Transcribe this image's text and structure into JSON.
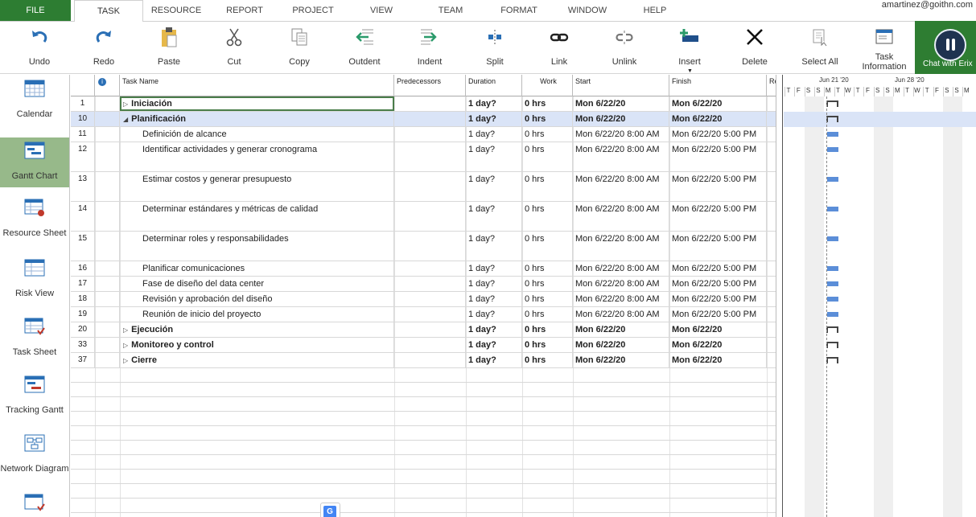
{
  "user": "amartinez@goithn.com",
  "tabs": [
    "FILE",
    "TASK",
    "RESOURCE",
    "REPORT",
    "PROJECT",
    "VIEW",
    "TEAM",
    "FORMAT",
    "WINDOW",
    "HELP"
  ],
  "ribbon": {
    "undo": "Undo",
    "redo": "Redo",
    "paste": "Paste",
    "cut": "Cut",
    "copy": "Copy",
    "outdent": "Outdent",
    "indent": "Indent",
    "split": "Split",
    "link": "Link",
    "unlink": "Unlink",
    "insert": "Insert",
    "delete": "Delete",
    "select_all": "Select All",
    "task_information": "Task Information",
    "chat": "Chat with Erix"
  },
  "views": [
    "Calendar",
    "Gantt Chart",
    "Resource Sheet",
    "Risk View",
    "Task Sheet",
    "Tracking Gantt",
    "Network Diagram"
  ],
  "columns": {
    "task_name": "Task Name",
    "predecessors": "Predecessors",
    "duration": "Duration",
    "work": "Work",
    "start": "Start",
    "finish": "Finish",
    "re": "Re"
  },
  "tasks": [
    {
      "id": "1",
      "name": "Iniciación",
      "duration": "1 day?",
      "work": "0 hrs",
      "start": "Mon 6/22/20",
      "finish": "Mon 6/22/20"
    },
    {
      "id": "10",
      "name": "Planificación",
      "duration": "1 day?",
      "work": "0 hrs",
      "start": "Mon 6/22/20",
      "finish": "Mon 6/22/20"
    },
    {
      "id": "11",
      "name": "Definición de alcance",
      "duration": "1 day?",
      "work": "0 hrs",
      "start": "Mon 6/22/20 8:00 AM",
      "finish": "Mon 6/22/20 5:00 PM"
    },
    {
      "id": "12",
      "name": "Identificar actividades y generar cronograma",
      "duration": "1 day?",
      "work": "0 hrs",
      "start": "Mon 6/22/20 8:00 AM",
      "finish": "Mon 6/22/20 5:00 PM"
    },
    {
      "id": "13",
      "name": "Estimar costos y generar presupuesto",
      "duration": "1 day?",
      "work": "0 hrs",
      "start": "Mon 6/22/20 8:00 AM",
      "finish": "Mon 6/22/20 5:00 PM"
    },
    {
      "id": "14",
      "name": "Determinar estándares y métricas de calidad",
      "duration": "1 day?",
      "work": "0 hrs",
      "start": "Mon 6/22/20 8:00 AM",
      "finish": "Mon 6/22/20 5:00 PM"
    },
    {
      "id": "15",
      "name": "Determinar roles y responsabilidades",
      "duration": "1 day?",
      "work": "0 hrs",
      "start": "Mon 6/22/20 8:00 AM",
      "finish": "Mon 6/22/20 5:00 PM"
    },
    {
      "id": "16",
      "name": "Planificar comunicaciones",
      "duration": "1 day?",
      "work": "0 hrs",
      "start": "Mon 6/22/20 8:00 AM",
      "finish": "Mon 6/22/20 5:00 PM"
    },
    {
      "id": "17",
      "name": "Fase de diseño del data center",
      "duration": "1 day?",
      "work": "0 hrs",
      "start": "Mon 6/22/20 8:00 AM",
      "finish": "Mon 6/22/20 5:00 PM"
    },
    {
      "id": "18",
      "name": "Revisión y aprobación del diseño",
      "duration": "1 day?",
      "work": "0 hrs",
      "start": "Mon 6/22/20 8:00 AM",
      "finish": "Mon 6/22/20 5:00 PM"
    },
    {
      "id": "19",
      "name": "Reunión de inicio del proyecto",
      "duration": "1 day?",
      "work": "0 hrs",
      "start": "Mon 6/22/20 8:00 AM",
      "finish": "Mon 6/22/20 5:00 PM"
    },
    {
      "id": "20",
      "name": "Ejecución",
      "duration": "1 day?",
      "work": "0 hrs",
      "start": "Mon 6/22/20",
      "finish": "Mon 6/22/20"
    },
    {
      "id": "33",
      "name": "Monitoreo y control",
      "duration": "1 day?",
      "work": "0 hrs",
      "start": "Mon 6/22/20",
      "finish": "Mon 6/22/20"
    },
    {
      "id": "37",
      "name": "Cierre",
      "duration": "1 day?",
      "work": "0 hrs",
      "start": "Mon 6/22/20",
      "finish": "Mon 6/22/20"
    }
  ],
  "timeline": {
    "weeks": [
      "Jun 21 '20",
      "Jun 28 '20"
    ],
    "days": [
      "T",
      "F",
      "S",
      "S",
      "M",
      "T",
      "W",
      "T",
      "F",
      "S",
      "S",
      "M",
      "T",
      "W",
      "T",
      "F",
      "S",
      "S",
      "M"
    ]
  },
  "colors": {
    "file_tab": "#2d7d32",
    "selected_row": "#dae4f7",
    "task_bar": "#5b8ed8",
    "active_view": "#97b98a"
  }
}
